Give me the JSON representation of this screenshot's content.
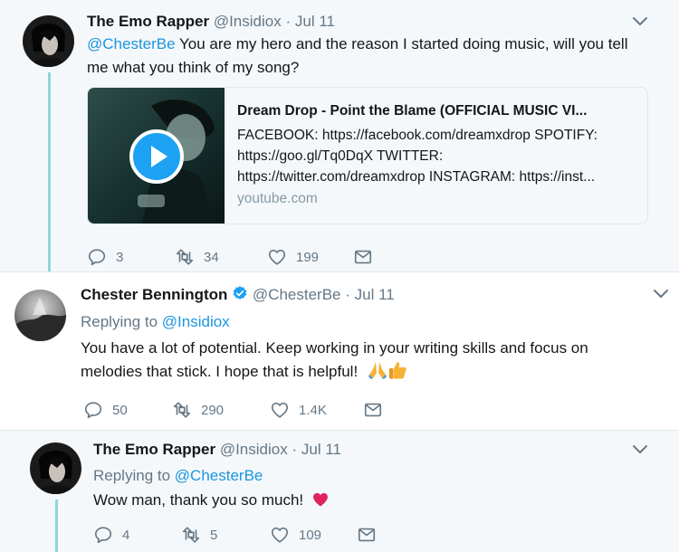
{
  "tweet1": {
    "name": "The Emo Rapper",
    "handle": "@Insidiox",
    "date": "Jul 11",
    "mention": "@ChesterBe",
    "text_line1": " You are my hero and the reason I started doing music, will you tell",
    "text_line2": "me what you think of my song?",
    "card": {
      "title": "Dream Drop - Point the Blame (OFFICIAL MUSIC VI...",
      "desc_line1": "FACEBOOK: https://facebook.com/dreamxdrop SPOTIFY:",
      "desc_line2": "https://goo.gl/Tq0DqX TWITTER:",
      "desc_line3": "https://twitter.com/dreamxdrop INSTAGRAM: https://inst...",
      "domain": "youtube.com"
    },
    "actions": {
      "replies": "3",
      "retweets": "34",
      "likes": "199"
    }
  },
  "tweet2": {
    "name": "Chester Bennington",
    "handle": "@ChesterBe",
    "date": "Jul 11",
    "replying_prefix": "Replying to ",
    "replying_to": "@Insidiox",
    "text_line1": "You have a lot of potential. Keep working in your writing skills and focus on",
    "text_line2": "melodies that stick. I hope that is helpful!",
    "actions": {
      "replies": "50",
      "retweets": "290",
      "likes": "1.4K"
    }
  },
  "tweet3": {
    "name": "The Emo Rapper",
    "handle": "@Insidiox",
    "date": "Jul 11",
    "replying_prefix": "Replying to ",
    "replying_to": "@ChesterBe",
    "text": "Wow man, thank you so much!",
    "actions": {
      "replies": "4",
      "retweets": "5",
      "likes": "109"
    }
  },
  "separator": "·",
  "colors": {
    "link": "#1b95e0",
    "muted": "#657786",
    "thread": "#8cd6da",
    "verified": "#1da1f2",
    "heart": "#e0245e"
  },
  "icons": [
    "chevron-down-icon",
    "reply-icon",
    "retweet-icon",
    "heart-icon",
    "message-icon",
    "verified-badge-icon",
    "play-icon",
    "folded-hands-emoji",
    "thumbs-up-emoji",
    "red-heart-emoji"
  ]
}
